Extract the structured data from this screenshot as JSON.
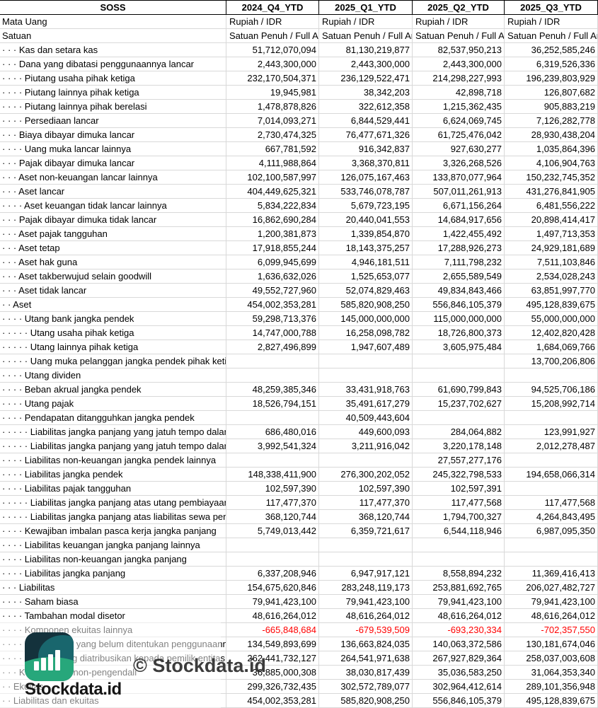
{
  "header": {
    "entity": "SOSS",
    "columns": [
      "2024_Q4_YTD",
      "2025_Q1_YTD",
      "2025_Q2_YTD",
      "2025_Q3_YTD"
    ]
  },
  "meta": {
    "currency_label": "Mata Uang",
    "currency_value": "Rupiah / IDR",
    "unit_label": "Satuan",
    "unit_value": "Satuan Penuh / Full Amount"
  },
  "rows": [
    {
      "indent": 3,
      "label": "Kas dan setara kas",
      "values": [
        "51,712,070,094",
        "81,130,219,877",
        "82,537,950,213",
        "36,252,585,246"
      ]
    },
    {
      "indent": 3,
      "label": "Dana yang dibatasi penggunaannya lancar",
      "values": [
        "2,443,300,000",
        "2,443,300,000",
        "2,443,300,000",
        "6,319,526,336"
      ]
    },
    {
      "indent": 4,
      "label": "Piutang usaha pihak ketiga",
      "values": [
        "232,170,504,371",
        "236,129,522,471",
        "214,298,227,993",
        "196,239,803,929"
      ]
    },
    {
      "indent": 4,
      "label": "Piutang lainnya pihak ketiga",
      "values": [
        "19,945,981",
        "38,342,203",
        "42,898,718",
        "126,807,682"
      ]
    },
    {
      "indent": 4,
      "label": "Piutang lainnya pihak berelasi",
      "values": [
        "1,478,878,826",
        "322,612,358",
        "1,215,362,435",
        "905,883,219"
      ]
    },
    {
      "indent": 4,
      "label": "Persediaan lancar",
      "values": [
        "7,014,093,271",
        "6,844,529,441",
        "6,624,069,745",
        "7,126,282,778"
      ]
    },
    {
      "indent": 3,
      "label": "Biaya dibayar dimuka lancar",
      "values": [
        "2,730,474,325",
        "76,477,671,326",
        "61,725,476,042",
        "28,930,438,204"
      ]
    },
    {
      "indent": 4,
      "label": "Uang muka lancar lainnya",
      "values": [
        "667,781,592",
        "916,342,837",
        "927,630,277",
        "1,035,864,396"
      ]
    },
    {
      "indent": 3,
      "label": "Pajak dibayar dimuka lancar",
      "values": [
        "4,111,988,864",
        "3,368,370,811",
        "3,326,268,526",
        "4,106,904,763"
      ]
    },
    {
      "indent": 3,
      "label": "Aset non-keuangan lancar lainnya",
      "values": [
        "102,100,587,997",
        "126,075,167,463",
        "133,870,077,964",
        "150,232,745,352"
      ]
    },
    {
      "indent": 3,
      "label": "Aset lancar",
      "values": [
        "404,449,625,321",
        "533,746,078,787",
        "507,011,261,913",
        "431,276,841,905"
      ]
    },
    {
      "indent": 4,
      "label": "Aset keuangan tidak lancar lainnya",
      "values": [
        "5,834,222,834",
        "5,679,723,195",
        "6,671,156,264",
        "6,481,556,222"
      ]
    },
    {
      "indent": 3,
      "label": "Pajak dibayar dimuka tidak lancar",
      "values": [
        "16,862,690,284",
        "20,440,041,553",
        "14,684,917,656",
        "20,898,414,417"
      ]
    },
    {
      "indent": 3,
      "label": "Aset pajak tangguhan",
      "values": [
        "1,200,381,873",
        "1,339,854,870",
        "1,422,455,492",
        "1,497,713,353"
      ]
    },
    {
      "indent": 3,
      "label": "Aset tetap",
      "values": [
        "17,918,855,244",
        "18,143,375,257",
        "17,288,926,273",
        "24,929,181,689"
      ]
    },
    {
      "indent": 3,
      "label": "Aset hak guna",
      "values": [
        "6,099,945,699",
        "4,946,181,511",
        "7,111,798,232",
        "7,511,103,846"
      ]
    },
    {
      "indent": 3,
      "label": "Aset takberwujud selain goodwill",
      "values": [
        "1,636,632,026",
        "1,525,653,077",
        "2,655,589,549",
        "2,534,028,243"
      ]
    },
    {
      "indent": 3,
      "label": "Aset tidak lancar",
      "values": [
        "49,552,727,960",
        "52,074,829,463",
        "49,834,843,466",
        "63,851,997,770"
      ]
    },
    {
      "indent": 2,
      "label": "Aset",
      "values": [
        "454,002,353,281",
        "585,820,908,250",
        "556,846,105,379",
        "495,128,839,675"
      ]
    },
    {
      "indent": 4,
      "label": "Utang bank jangka pendek",
      "values": [
        "59,298,713,376",
        "145,000,000,000",
        "115,000,000,000",
        "55,000,000,000"
      ]
    },
    {
      "indent": 5,
      "label": "Utang usaha pihak ketiga",
      "values": [
        "14,747,000,788",
        "16,258,098,782",
        "18,726,800,373",
        "12,402,820,428"
      ]
    },
    {
      "indent": 5,
      "label": "Utang lainnya pihak ketiga",
      "values": [
        "2,827,496,899",
        "1,947,607,489",
        "3,605,975,484",
        "1,684,069,766"
      ]
    },
    {
      "indent": 5,
      "label": "Uang muka pelanggan jangka pendek pihak ketiga",
      "values": [
        "",
        "",
        "",
        "13,700,206,806"
      ]
    },
    {
      "indent": 4,
      "label": "Utang dividen",
      "values": [
        "",
        "",
        "",
        ""
      ]
    },
    {
      "indent": 4,
      "label": "Beban akrual jangka pendek",
      "values": [
        "48,259,385,346",
        "33,431,918,763",
        "61,690,799,843",
        "94,525,706,186"
      ]
    },
    {
      "indent": 4,
      "label": "Utang pajak",
      "values": [
        "18,526,794,151",
        "35,491,617,279",
        "15,237,702,627",
        "15,208,992,714"
      ]
    },
    {
      "indent": 4,
      "label": "Pendapatan ditangguhkan jangka pendek",
      "values": [
        "",
        "40,509,443,604",
        "",
        ""
      ]
    },
    {
      "indent": 5,
      "label": "Liabilitas jangka panjang yang jatuh tempo dalam satu tahun atas utang pembiayaan",
      "values": [
        "686,480,016",
        "449,600,093",
        "284,064,882",
        "123,991,927"
      ]
    },
    {
      "indent": 5,
      "label": "Liabilitas jangka panjang yang jatuh tempo dalam satu tahun atas liabilitas sewa pembiayaan",
      "values": [
        "3,992,541,324",
        "3,211,916,042",
        "3,220,178,148",
        "2,012,278,487"
      ]
    },
    {
      "indent": 4,
      "label": "Liabilitas non-keuangan jangka pendek lainnya",
      "values": [
        "",
        "",
        "27,557,277,176",
        ""
      ]
    },
    {
      "indent": 4,
      "label": "Liabilitas jangka pendek",
      "values": [
        "148,338,411,900",
        "276,300,202,052",
        "245,322,798,533",
        "194,658,066,314"
      ]
    },
    {
      "indent": 4,
      "label": "Liabilitas pajak tangguhan",
      "values": [
        "102,597,390",
        "102,597,390",
        "102,597,391",
        ""
      ]
    },
    {
      "indent": 5,
      "label": "Liabilitas jangka panjang atas utang pembiayaan",
      "values": [
        "117,477,370",
        "117,477,370",
        "117,477,568",
        "117,477,568"
      ]
    },
    {
      "indent": 5,
      "label": "Liabilitas jangka panjang atas liabilitas sewa pembiayaan",
      "values": [
        "368,120,744",
        "368,120,744",
        "1,794,700,327",
        "4,264,843,495"
      ]
    },
    {
      "indent": 4,
      "label": "Kewajiban imbalan pasca kerja jangka panjang",
      "values": [
        "5,749,013,442",
        "6,359,721,617",
        "6,544,118,946",
        "6,987,095,350"
      ]
    },
    {
      "indent": 4,
      "label": "Liabilitas keuangan jangka panjang lainnya",
      "values": [
        "",
        "",
        "",
        ""
      ]
    },
    {
      "indent": 4,
      "label": "Liabilitas non-keuangan jangka panjang",
      "values": [
        "",
        "",
        "",
        ""
      ]
    },
    {
      "indent": 4,
      "label": "Liabilitas jangka panjang",
      "values": [
        "6,337,208,946",
        "6,947,917,121",
        "8,558,894,232",
        "11,369,416,413"
      ]
    },
    {
      "indent": 3,
      "label": "Liabilitas",
      "values": [
        "154,675,620,846",
        "283,248,119,173",
        "253,881,692,765",
        "206,027,482,727"
      ]
    },
    {
      "indent": 4,
      "label": "Saham biasa",
      "values": [
        "79,941,423,100",
        "79,941,423,100",
        "79,941,423,100",
        "79,941,423,100"
      ]
    },
    {
      "indent": 4,
      "label": "Tambahan modal disetor",
      "values": [
        "48,616,264,012",
        "48,616,264,012",
        "48,616,264,012",
        "48,616,264,012"
      ]
    },
    {
      "indent": 4,
      "label": "Komponen ekuitas lainnya",
      "values": [
        "-665,848,684",
        "-679,539,509",
        "-693,230,334",
        "-702,357,550"
      ]
    },
    {
      "indent": 5,
      "label": "Saldo laba yang belum ditentukan penggunaannya",
      "values": [
        "134,549,893,699",
        "136,663,824,035",
        "140,063,372,586",
        "130,181,674,046"
      ]
    },
    {
      "indent": 4,
      "label": "Ekuitas yang diatribusikan kepada pemilik entitas induk",
      "values": [
        "262,441,732,127",
        "264,541,971,638",
        "267,927,829,364",
        "258,037,003,608"
      ]
    },
    {
      "indent": 3,
      "label": "Kepentingan non-pengendali",
      "values": [
        "36,885,000,308",
        "38,030,817,439",
        "35,036,583,250",
        "31,064,353,340"
      ]
    },
    {
      "indent": 2,
      "label": "Ekuitas",
      "values": [
        "299,326,732,435",
        "302,572,789,077",
        "302,964,412,614",
        "289,101,356,948"
      ]
    },
    {
      "indent": 2,
      "label": "Liabilitas dan ekuitas",
      "values": [
        "454,002,353,281",
        "585,820,908,250",
        "556,846,105,379",
        "495,128,839,675"
      ]
    }
  ],
  "watermark": {
    "copyright": "© Stockdata.id",
    "brand": "Stockdata.id",
    "icon": "bar-chart-logo"
  },
  "colors": {
    "negative": "#ff0000",
    "gridline": "#d9d9d9",
    "header_border": "#000000",
    "logo_dark": "#14323c",
    "logo_teal": "#19666d",
    "logo_green": "#27a77b"
  }
}
